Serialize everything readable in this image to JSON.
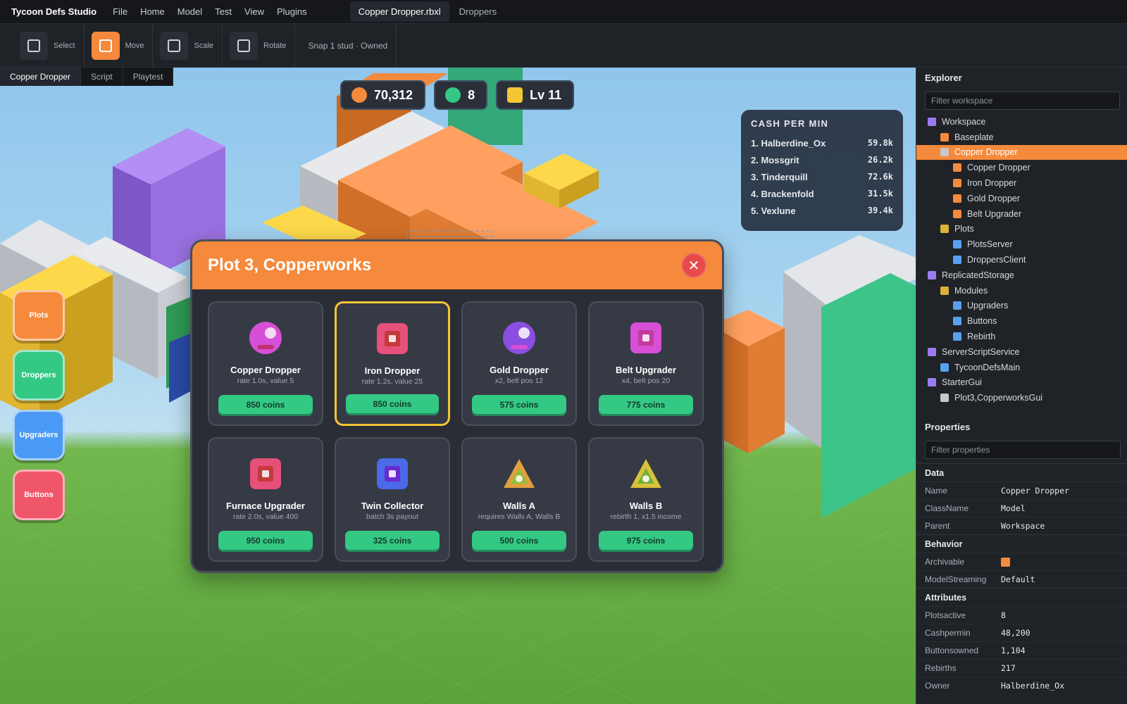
{
  "menubar": {
    "brand": "Tycoon Defs Studio",
    "items": [
      "File",
      "Home",
      "Model",
      "Test",
      "View",
      "Plugins"
    ],
    "doc_tab": "Copper Dropper.rbxl",
    "doc_tab2": "Droppers"
  },
  "toolbar": {
    "tools": [
      {
        "label": "Select",
        "active": false
      },
      {
        "label": "Move",
        "active": true
      },
      {
        "label": "Scale",
        "active": false
      },
      {
        "label": "Rotate",
        "active": false
      }
    ],
    "snap": "Snap 1 stud · Owned"
  },
  "viewport_tabs": [
    "Copper Dropper",
    "Script",
    "Playtest"
  ],
  "hud": {
    "coins": "70,312",
    "gems": "8",
    "level": "Lv 11",
    "colors": {
      "coins": "#f58a3c",
      "gems": "#34c885",
      "level": "#f3c634"
    }
  },
  "leaderboard": {
    "title": "CASH PER MIN",
    "rows": [
      {
        "name": "1. Halberdine_Ox",
        "value": "59.8k"
      },
      {
        "name": "2. Mossgrit",
        "value": "26.2k"
      },
      {
        "name": "3. Tinderquill",
        "value": "72.6k"
      },
      {
        "name": "4. Brackenfold",
        "value": "31.5k"
      },
      {
        "name": "5. Vexlune",
        "value": "39.4k"
      }
    ]
  },
  "side_buttons": [
    {
      "label": "Plots",
      "color": "#f58a3c"
    },
    {
      "label": "Droppers",
      "color": "#34c885"
    },
    {
      "label": "Upgraders",
      "color": "#4a9af5"
    },
    {
      "label": "Buttons",
      "color": "#f0566a"
    }
  ],
  "modal": {
    "title": "Plot 3, Copperworks",
    "close_icon": "close-icon",
    "items": [
      {
        "name": "Copper Dropper",
        "sub": "rate 1.0s, value 5",
        "price": "850 coins",
        "icon": "sphere-icon",
        "color": "#d64fd6",
        "selected": false
      },
      {
        "name": "Iron Dropper",
        "sub": "rate 1.2s, value 25",
        "price": "850 coins",
        "icon": "square-icon",
        "color": "#e6507a",
        "selected": true
      },
      {
        "name": "Gold Dropper",
        "sub": "x2, belt pos 12",
        "price": "575 coins",
        "icon": "sphere-icon",
        "color": "#8a4fe0",
        "selected": false
      },
      {
        "name": "Belt Upgrader",
        "sub": "x4, belt pos 20",
        "price": "775 coins",
        "icon": "square-icon",
        "color": "#d64fd6",
        "selected": false
      },
      {
        "name": "Furnace Upgrader",
        "sub": "rate 2.0s, value 400",
        "price": "950 coins",
        "icon": "square-icon",
        "color": "#e6507a",
        "selected": false
      },
      {
        "name": "Twin Collector",
        "sub": "batch 3s payout",
        "price": "325 coins",
        "icon": "square-icon",
        "color": "#4a6ae8",
        "selected": false
      },
      {
        "name": "Walls A",
        "sub": "requires Walls A, Walls B",
        "price": "500 coins",
        "icon": "triangle-icon",
        "color": "#e0a040",
        "selected": false
      },
      {
        "name": "Walls B",
        "sub": "rebirth 1, x1.5 income",
        "price": "975 coins",
        "icon": "triangle-icon",
        "color": "#d9c23a",
        "selected": false
      }
    ]
  },
  "explorer": {
    "title": "Explorer",
    "filter_placeholder": "Filter workspace",
    "nodes": [
      {
        "label": "Workspace",
        "depth": 0,
        "color": "#9b7cf0",
        "selected": false
      },
      {
        "label": "Baseplate",
        "depth": 1,
        "color": "#f58a3c",
        "selected": false
      },
      {
        "label": "Copper Dropper",
        "depth": 1,
        "color": "#c8c8c8",
        "selected": true
      },
      {
        "label": "Copper Dropper",
        "depth": 2,
        "color": "#f58a3c",
        "selected": false
      },
      {
        "label": "Iron Dropper",
        "depth": 2,
        "color": "#f58a3c",
        "selected": false
      },
      {
        "label": "Gold Dropper",
        "depth": 2,
        "color": "#f58a3c",
        "selected": false
      },
      {
        "label": "Belt Upgrader",
        "depth": 2,
        "color": "#f58a3c",
        "selected": false
      },
      {
        "label": "Plots",
        "depth": 1,
        "color": "#d9b23a",
        "selected": false
      },
      {
        "label": "PlotsServer",
        "depth": 2,
        "color": "#5aa0f0",
        "selected": false
      },
      {
        "label": "DroppersClient",
        "depth": 2,
        "color": "#5aa0f0",
        "selected": false
      },
      {
        "label": "ReplicatedStorage",
        "depth": 0,
        "color": "#9b7cf0",
        "selected": false
      },
      {
        "label": "Modules",
        "depth": 1,
        "color": "#d9b23a",
        "selected": false
      },
      {
        "label": "Upgraders",
        "depth": 2,
        "color": "#5aa0f0",
        "selected": false
      },
      {
        "label": "Buttons",
        "depth": 2,
        "color": "#5aa0f0",
        "selected": false
      },
      {
        "label": "Rebirth",
        "depth": 2,
        "color": "#5aa0f0",
        "selected": false
      },
      {
        "label": "ServerScriptService",
        "depth": 0,
        "color": "#9b7cf0",
        "selected": false
      },
      {
        "label": "TycoonDefsMain",
        "depth": 1,
        "color": "#5aa0f0",
        "selected": false
      },
      {
        "label": "StarterGui",
        "depth": 0,
        "color": "#9b7cf0",
        "selected": false
      },
      {
        "label": "Plot3,CopperworksGui",
        "depth": 1,
        "color": "#c8c8c8",
        "selected": false
      }
    ]
  },
  "properties": {
    "title": "Properties",
    "filter_placeholder": "Filter properties",
    "sections": [
      {
        "title": "Data",
        "rows": [
          {
            "key": "Name",
            "value": "Copper Dropper"
          },
          {
            "key": "ClassName",
            "value": "Model"
          },
          {
            "key": "Parent",
            "value": "Workspace"
          }
        ]
      },
      {
        "title": "Behavior",
        "rows": [
          {
            "key": "Archivable",
            "value": "",
            "swatch": "#f58a3c"
          },
          {
            "key": "ModelStreaming",
            "value": "Default"
          }
        ]
      },
      {
        "title": "Attributes",
        "rows": [
          {
            "key": "Plotsactive",
            "value": "8"
          },
          {
            "key": "Cashpermin",
            "value": "48,200"
          },
          {
            "key": "Buttonsowned",
            "value": "1,104"
          },
          {
            "key": "Rebirths",
            "value": "217"
          },
          {
            "key": "Owner",
            "value": "Halberdine_Ox"
          }
        ]
      }
    ]
  }
}
